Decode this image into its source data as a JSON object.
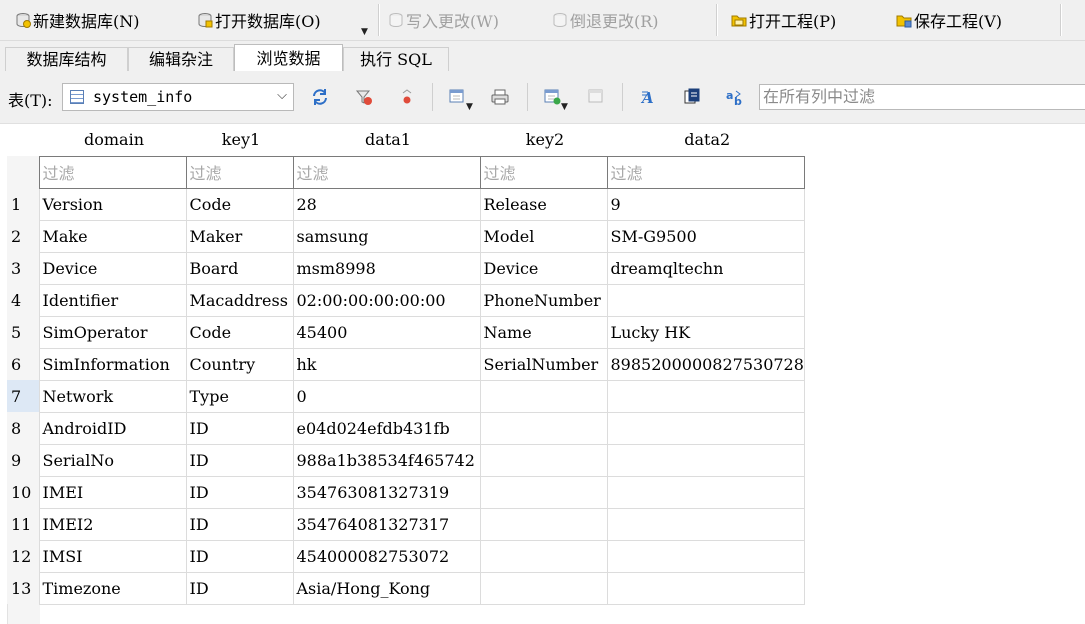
{
  "toolbar": {
    "new_db": "新建数据库(N)",
    "open_db": "打开数据库(O)",
    "write_changes": "写入更改(W)",
    "revert_changes": "倒退更改(R)",
    "open_project": "打开工程(P)",
    "save_project": "保存工程(V)"
  },
  "tabs": [
    "数据库结构",
    "编辑杂注",
    "浏览数据",
    "执行 SQL"
  ],
  "active_tab": "浏览数据",
  "filterbar": {
    "table_label": "表(T):",
    "table_value": "system_info",
    "filter_all_placeholder": "在所有列中过滤"
  },
  "grid": {
    "columns": [
      "domain",
      "key1",
      "data1",
      "key2",
      "data2"
    ],
    "filter_placeholder": "过滤",
    "selected_row": 7,
    "rows": [
      [
        "1",
        "Version",
        "Code",
        "28",
        "Release",
        "9"
      ],
      [
        "2",
        "Make",
        "Maker",
        "samsung",
        "Model",
        "SM-G9500"
      ],
      [
        "3",
        "Device",
        "Board",
        "msm8998",
        "Device",
        "dreamqltechn"
      ],
      [
        "4",
        "Identifier",
        "Macaddress",
        "02:00:00:00:00:00",
        "PhoneNumber",
        ""
      ],
      [
        "5",
        "SimOperator",
        "Code",
        "45400",
        "Name",
        "Lucky HK"
      ],
      [
        "6",
        "SimInformation",
        "Country",
        "hk",
        "SerialNumber",
        "8985200000827530728"
      ],
      [
        "7",
        "Network",
        "Type",
        "0",
        "",
        ""
      ],
      [
        "8",
        "AndroidID",
        "ID",
        "e04d024efdb431fb",
        "",
        ""
      ],
      [
        "9",
        "SerialNo",
        "ID",
        "988a1b38534f465742",
        "",
        ""
      ],
      [
        "10",
        "IMEI",
        "ID",
        "354763081327319",
        "",
        ""
      ],
      [
        "11",
        "IMEI2",
        "ID",
        "354764081327317",
        "",
        ""
      ],
      [
        "12",
        "IMSI",
        "ID",
        "454000082753072",
        "",
        ""
      ],
      [
        "13",
        "Timezone",
        "ID",
        "Asia/Hong_Kong",
        "",
        ""
      ]
    ]
  },
  "colors": {
    "toolbar_bg": "#f0f0f0",
    "grid_line": "#dcdcdc",
    "selected_row_header": "#dde8f5",
    "filter_text": "#a8a8a8"
  }
}
